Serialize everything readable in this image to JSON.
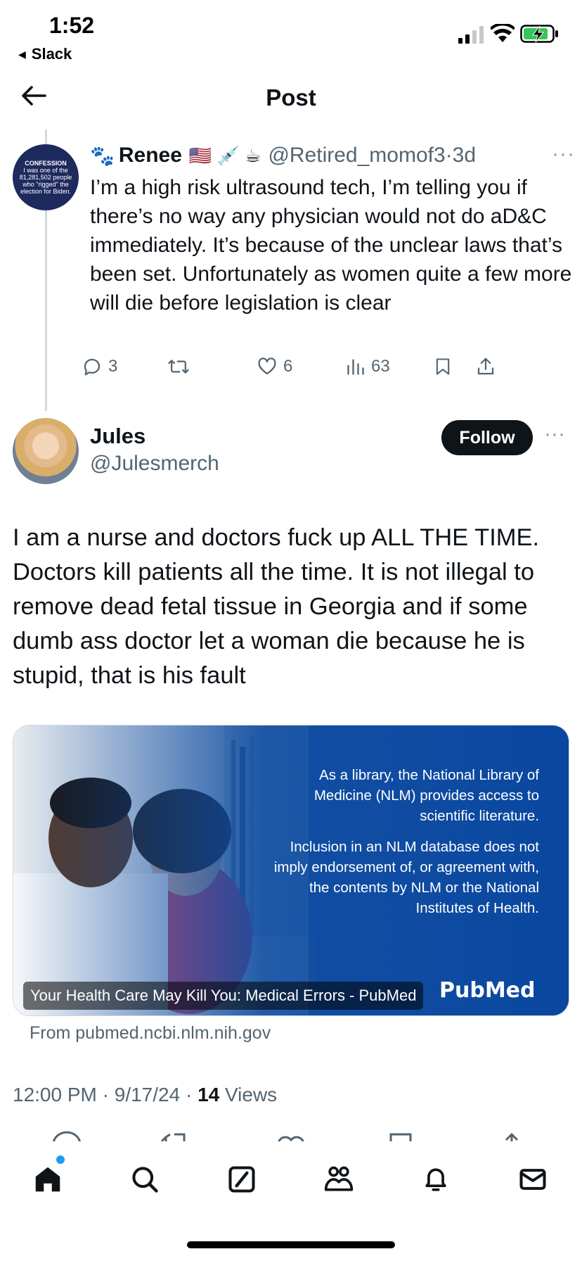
{
  "status_bar": {
    "time": "1:52",
    "back_app": "Slack"
  },
  "header": {
    "title": "Post"
  },
  "parent_tweet": {
    "avatar_text": {
      "heading": "CONFESSION",
      "body": "I was one of the 81,281,502 people who \"rigged\" the election for Biden."
    },
    "display_name": "Renee",
    "name_emojis": "🇺🇸 💉 ☕",
    "paw_icon": "🐾",
    "handle": "@Retired_momof3",
    "separator": "·",
    "age": "3d",
    "body": "I’m a high risk ultrasound tech, I’m telling you if there’s no way any physician would not do aD&C immediately. It’s because of the unclear laws that’s been set. Unfortunately as women quite a few more will die before legislation is clear",
    "replies": "3",
    "likes": "6",
    "views": "63"
  },
  "main_tweet": {
    "display_name": "Jules",
    "handle": "@Julesmerch",
    "follow_label": "Follow",
    "body": "I am a nurse and doctors fuck up ALL THE TIME. Doctors kill patients all the time.  It is not illegal to remove dead fetal tissue in Georgia and if some dumb ass doctor let a woman die because he is stupid, that is his fault",
    "card": {
      "notice_1": "As a library, the National Library of Medicine (NLM) provides access to scientific literature.",
      "notice_2": "Inclusion in an NLM database does not imply endorsement of, or agreement with, the contents by NLM or the National Institutes of Health.",
      "logo_text": "PubMed",
      "caption": "Your Health Care May Kill You: Medical Errors - PubMed",
      "source": "From pubmed.ncbi.nlm.nih.gov"
    },
    "time": "12:00 PM",
    "date": "9/17/24",
    "views_count": "14",
    "views_label": "Views",
    "separator": "·"
  },
  "tab_bar": {
    "items": [
      "home-icon",
      "search-icon",
      "compose-icon",
      "communities-icon",
      "notifications-icon",
      "messages-icon"
    ]
  },
  "colors": {
    "text_primary": "#0f1419",
    "text_secondary": "#536471",
    "accent_blue": "#1d9bf0",
    "follow_button_bg": "#0f1419",
    "card_blue": "#0b4aa0"
  }
}
